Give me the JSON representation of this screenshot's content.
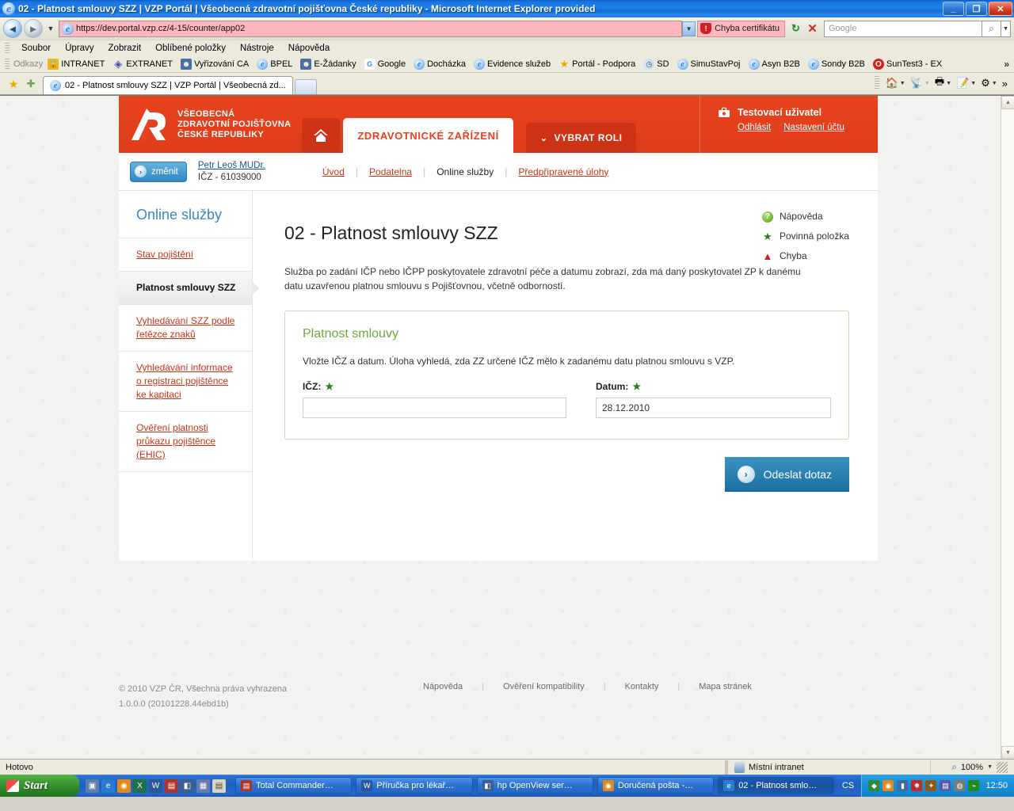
{
  "window": {
    "title": "02 - Platnost smlouvy SZZ | VZP Portál | Všeobecná zdravotní pojišťovna České republiky - Microsoft Internet Explorer provided",
    "minimize": "_",
    "maximize": "❐",
    "close": "✕"
  },
  "browser": {
    "url": "https://dev.portal.vzp.cz/4-15/counter/app02",
    "cert_error": "Chyba certifikátu",
    "refresh_glyph": "↻",
    "stop_glyph": "✕",
    "search_placeholder": "Google",
    "search_value": "",
    "back_glyph": "◄",
    "forward_glyph": "►",
    "addr_dropdown_glyph": "▼",
    "menu": [
      "Soubor",
      "Úpravy",
      "Zobrazit",
      "Oblíbené položky",
      "Nástroje",
      "Nápověda"
    ],
    "links_label": "Odkazy",
    "links": [
      {
        "label": "INTRANET",
        "icon": "lock-icon",
        "glyph": "🔒"
      },
      {
        "label": "EXTRANET",
        "icon": "diamond-icon",
        "glyph": "◈"
      },
      {
        "label": "Vyřizování CA",
        "icon": "person-icon",
        "glyph": "☻"
      },
      {
        "label": "BPEL",
        "icon": "ie-icon",
        "glyph": "e"
      },
      {
        "label": "E-Žádanky",
        "icon": "person-icon",
        "glyph": "☻"
      },
      {
        "label": "Google",
        "icon": "google-icon",
        "glyph": "G"
      },
      {
        "label": "Docházka",
        "icon": "ie-icon",
        "glyph": "e"
      },
      {
        "label": "Evidence služeb",
        "icon": "ie-icon",
        "glyph": "e"
      },
      {
        "label": "Portál - Podpora",
        "icon": "star-icon",
        "glyph": "★"
      },
      {
        "label": "SD",
        "icon": "clock-icon",
        "glyph": "◷"
      },
      {
        "label": "SimuStavPoj",
        "icon": "ie-icon",
        "glyph": "e"
      },
      {
        "label": "Asyn B2B",
        "icon": "ie-icon",
        "glyph": "e"
      },
      {
        "label": "Sondy B2B",
        "icon": "ie-icon",
        "glyph": "e"
      },
      {
        "label": "SunTest3 - EX",
        "icon": "opera-icon",
        "glyph": "O"
      }
    ],
    "links_overflow": "»",
    "tab_title": "02 - Platnost smlouvy SZZ | VZP Portál | Všeobecná zd...",
    "fav_glyph": "★",
    "add_fav_glyph": "✚",
    "toolbar_overflow": "»",
    "right_tools": [
      {
        "name": "home-icon",
        "glyph": "🏠"
      },
      {
        "name": "feeds-icon",
        "glyph": "◉"
      },
      {
        "name": "print-icon",
        "glyph": "🖶"
      },
      {
        "name": "page-icon",
        "glyph": "📄"
      },
      {
        "name": "tools-gear-icon",
        "glyph": "⚙"
      }
    ]
  },
  "site": {
    "logo_lines": [
      "VŠEOBECNÁ",
      "ZDRAVOTNÍ POJIŠŤOVNA",
      "ČESKÉ REPUBLIKY"
    ],
    "home_icon": "home-icon",
    "tab_active": "ZDRAVOTNICKÉ ZAŘÍZENÍ",
    "role_tab": "VYBRAT ROLI",
    "role_caret": "⌄",
    "user": {
      "name": "Testovací uživatel",
      "logout": "Odhlásit",
      "settings": "Nastavení účtu"
    },
    "change_button": "změnit",
    "change_glyph": "›",
    "person_name": "Petr Leoš MUDr.",
    "person_icz": "IČZ - 61039000",
    "breadcrumbs": [
      {
        "label": "Úvod",
        "active": false
      },
      {
        "label": "Podatelna",
        "active": false
      },
      {
        "label": "Online služby",
        "active": true
      },
      {
        "label": "Předpřipravené úlohy",
        "active": false
      }
    ],
    "breadcrumb_sep": "|"
  },
  "sidebar": {
    "title": "Online služby",
    "items": [
      {
        "label": "Stav pojištění",
        "active": false
      },
      {
        "label": "Platnost smlouvy SZZ",
        "active": true
      },
      {
        "label": "Vyhledávání SZZ podle řetězce znaků",
        "active": false
      },
      {
        "label": "Vyhledávání informace o registraci pojištěnce ke kapitaci",
        "active": false
      },
      {
        "label": "Ověření platnosti průkazu pojištěnce (EHIC)",
        "active": false
      }
    ]
  },
  "main": {
    "legend": [
      {
        "label": "Nápověda",
        "icon": "help-icon",
        "glyph": "?"
      },
      {
        "label": "Povinná položka",
        "icon": "star-icon",
        "glyph": "★"
      },
      {
        "label": "Chyba",
        "icon": "warning-icon",
        "glyph": "▲"
      }
    ],
    "page_title": "02 - Platnost smlouvy SZZ",
    "intro": "Služba po zadání IČP nebo IČPP poskytovatele zdravotní péče a datumu zobrazí, zda má daný poskytovatel ZP k danému datu uzavřenou platnou smlouvu s Pojišťovnou, včetně odborností.",
    "panel": {
      "heading": "Platnost smlouvy",
      "text": "Vložte IČZ a datum. Úloha vyhledá, zda ZZ určené IČZ mělo k zadanému datu platnou smlouvu s VZP.",
      "field_icz_label": "IČZ:",
      "field_icz_value": "",
      "field_icz_placeholder": "",
      "field_date_label": "Datum:",
      "field_date_value": "28.12.2010",
      "required_glyph": "★"
    },
    "submit_label": "Odeslat dotaz",
    "submit_glyph": "›"
  },
  "footer": {
    "copyright": "© 2010 VZP ČR, Všechna práva vyhrazena",
    "version": "1.0.0.0 (20101228.44ebd1b)",
    "links": [
      "Nápověda",
      "Ověření kompatibility",
      "Kontakty",
      "Mapa stránek"
    ],
    "sep": "|"
  },
  "status": {
    "text": "Hotovo",
    "zone": "Místní intranet",
    "zoom": "100%",
    "zoom_caret": "▼"
  },
  "taskbar": {
    "start": "Start",
    "quick_launch": [
      {
        "name": "show-desktop-icon",
        "glyph": "▣",
        "color": "#5a7fa8"
      },
      {
        "name": "ie-icon",
        "glyph": "e",
        "color": "#2a7ad0"
      },
      {
        "name": "media-icon",
        "glyph": "◉",
        "color": "#e08a1a"
      },
      {
        "name": "excel-icon",
        "glyph": "X",
        "color": "#1e7145"
      },
      {
        "name": "word-icon",
        "glyph": "W",
        "color": "#2b579a"
      },
      {
        "name": "totalcmd-icon",
        "glyph": "▤",
        "color": "#b0342a"
      },
      {
        "name": "app-icon",
        "glyph": "◧",
        "color": "#3b5f91"
      },
      {
        "name": "app2-icon",
        "glyph": "▦",
        "color": "#6a7aa8"
      },
      {
        "name": "notepad-icon",
        "glyph": "▤",
        "color": "#d8d8c0"
      }
    ],
    "tasks": [
      {
        "label": "Total Commander…",
        "icon": "totalcmd-icon",
        "glyph": "▤",
        "color": "#b0342a",
        "active": false
      },
      {
        "label": "Příručka pro lékař…",
        "icon": "word-icon",
        "glyph": "W",
        "color": "#2b579a",
        "active": false
      },
      {
        "label": "hp OpenView ser…",
        "icon": "hp-icon",
        "glyph": "◧",
        "color": "#3b5f91",
        "active": false
      },
      {
        "label": "Doručená pošta -…",
        "icon": "mail-icon",
        "glyph": "◉",
        "color": "#e08a1a",
        "active": false
      },
      {
        "label": "02 - Platnost smlo…",
        "icon": "ie-icon",
        "glyph": "e",
        "color": "#2a7ad0",
        "active": true
      }
    ],
    "language": "CS",
    "tray": [
      {
        "name": "tray-icon-1",
        "glyph": "◆",
        "color": "#2d8b3a"
      },
      {
        "name": "tray-icon-2",
        "glyph": "◉",
        "color": "#e08a1a"
      },
      {
        "name": "tray-icon-3",
        "glyph": "▮",
        "color": "#3a6ea5"
      },
      {
        "name": "tray-icon-4",
        "glyph": "✹",
        "color": "#c02a2a"
      },
      {
        "name": "tray-icon-5",
        "glyph": "✦",
        "color": "#8a5a1a"
      },
      {
        "name": "tray-icon-6",
        "glyph": "▤",
        "color": "#5a5aa8"
      },
      {
        "name": "tray-icon-7",
        "glyph": "◍",
        "color": "#7a7a7a"
      },
      {
        "name": "tray-icon-8",
        "glyph": "⌁",
        "color": "#1e8b1e"
      }
    ],
    "clock": "12:50"
  },
  "colors": {
    "brand_red": "#e8401f",
    "brand_red_dark": "#cf3316",
    "accent_blue": "#3e87c3",
    "panel_green": "#6fa83c",
    "link_red": "#cf3316",
    "button_blue": "#2f87bf"
  }
}
